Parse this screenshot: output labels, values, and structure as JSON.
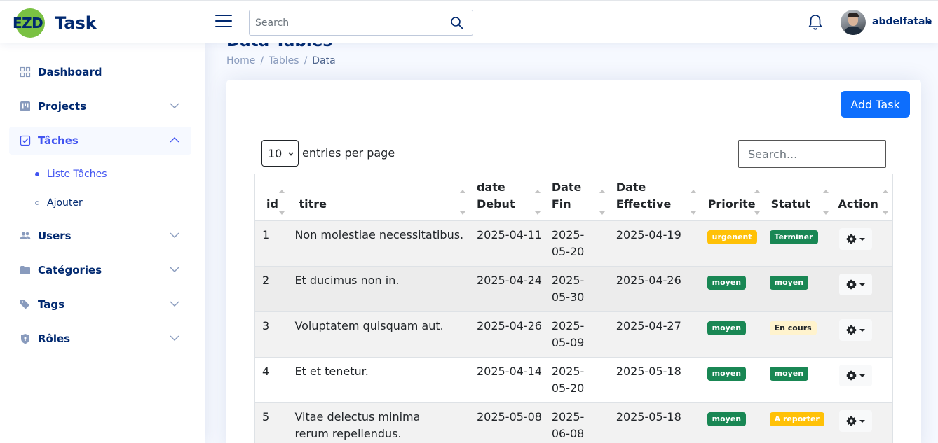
{
  "header": {
    "logo_mark": "EZD",
    "logo_text": "Task",
    "search_placeholder": "Search",
    "user_name": "abdelfatah"
  },
  "sidebar": {
    "items": [
      {
        "label": "Dashboard",
        "icon": "grid-icon"
      },
      {
        "label": "Projects",
        "icon": "kanban-icon"
      },
      {
        "label": "Tâches",
        "icon": "check-square-icon"
      },
      {
        "label": "Users",
        "icon": "people-icon"
      },
      {
        "label": "Catégories",
        "icon": "folder-icon"
      },
      {
        "label": "Tags",
        "icon": "tags-icon"
      },
      {
        "label": "Rôles",
        "icon": "shield-icon"
      }
    ],
    "sub_items": [
      {
        "label": "Liste Tâches"
      },
      {
        "label": "Ajouter"
      }
    ]
  },
  "page": {
    "title": "Data Tables",
    "breadcrumb": [
      "Home",
      "Tables",
      "Data"
    ]
  },
  "card": {
    "add_button": "Add Task",
    "per_page_value": "10",
    "per_page_text": "entries per page",
    "search_placeholder": "Search..."
  },
  "table": {
    "columns": [
      "id",
      "titre",
      "date Debut",
      "Date Fin",
      "Date Effective",
      "Priorite",
      "Statut",
      "Action"
    ],
    "rows": [
      {
        "id": "1",
        "titre": "Non molestiae necessitatibus.",
        "debut": "2025-04-11",
        "fin": "2025-05-20",
        "effective": "2025-04-19",
        "priorite": "urgenent",
        "statut": "Terminer"
      },
      {
        "id": "2",
        "titre": "Et ducimus non in.",
        "debut": "2025-04-24",
        "fin": "2025-05-30",
        "effective": "2025-04-26",
        "priorite": "moyen",
        "statut": "moyen"
      },
      {
        "id": "3",
        "titre": "Voluptatem quisquam aut.",
        "debut": "2025-04-26",
        "fin": "2025-05-09",
        "effective": "2025-04-27",
        "priorite": "moyen",
        "statut": "En cours"
      },
      {
        "id": "4",
        "titre": "Et et tenetur.",
        "debut": "2025-04-14",
        "fin": "2025-05-20",
        "effective": "2025-05-18",
        "priorite": "moyen",
        "statut": "moyen"
      },
      {
        "id": "5",
        "titre": "Vitae delectus minima rerum repellendus.",
        "debut": "2025-05-08",
        "fin": "2025-06-08",
        "effective": "2025-05-18",
        "priorite": "moyen",
        "statut": "A reporter"
      }
    ]
  },
  "colors": {
    "brand": "#012970",
    "accent": "#4154f1",
    "primary_button": "#0d6efd",
    "badge_success": "#198754",
    "badge_warning": "#ffc107",
    "badge_light_warning": "#fff3cd"
  }
}
